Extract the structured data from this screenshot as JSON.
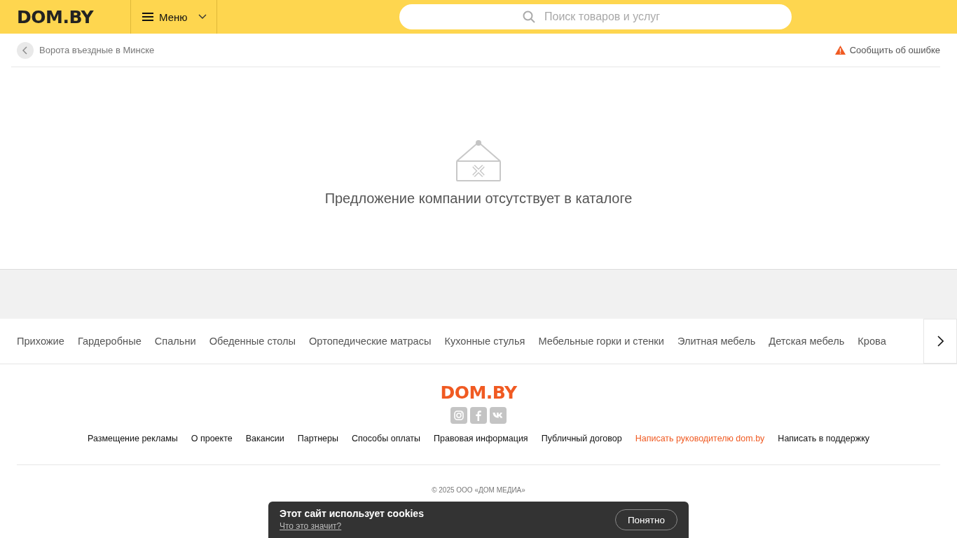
{
  "header": {
    "logo": "DOM.BY",
    "menu_button": "Меню",
    "search": {
      "placeholder": "Поиск товаров и услуг"
    }
  },
  "breadcrumb": {
    "back_link": "Ворота въездные в Минске",
    "report_link": "Сообщить об ошибке"
  },
  "empty_state": {
    "message": "Предложение компании отсутствует в каталоге"
  },
  "categories": [
    "Прихожие",
    "Гардеробные",
    "Спальни",
    "Обеденные столы",
    "Ортопедические матрасы",
    "Кухонные стулья",
    "Мебельные горки и стенки",
    "Элитная мебель",
    "Детская мебель",
    "Крова"
  ],
  "footer": {
    "logo": "DOM.BY",
    "social": [
      {
        "kind": "instagram"
      },
      {
        "kind": "facebook"
      },
      {
        "kind": "vk"
      }
    ],
    "links": [
      {
        "label": "Размещение рекламы",
        "highlighted": false
      },
      {
        "label": "О проекте",
        "highlighted": false
      },
      {
        "label": "Вакансии",
        "highlighted": false
      },
      {
        "label": "Партнеры",
        "highlighted": false
      },
      {
        "label": "Способы оплаты",
        "highlighted": false
      },
      {
        "label": "Правовая информация",
        "highlighted": false
      },
      {
        "label": "Публичный договор",
        "highlighted": false
      },
      {
        "label": "Написать руководителю dom.by",
        "highlighted": true
      },
      {
        "label": "Написать в поддержку",
        "highlighted": false
      }
    ],
    "copyright": "© 2025 ООО «ДОМ МЕДИА»"
  },
  "cookie_banner": {
    "title": "Этот сайт использует cookies",
    "link": "Что это значит?",
    "button": "Понятно"
  }
}
